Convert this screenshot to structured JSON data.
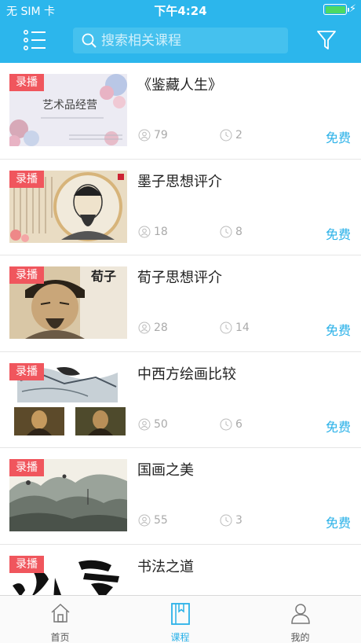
{
  "status_bar": {
    "carrier": "无 SIM 卡",
    "time": "下午4:24",
    "battery_state": "charging"
  },
  "header": {
    "menu_icon": "list-menu-icon",
    "search_placeholder": "搜索相关课程",
    "filter_icon": "filter-funnel-icon",
    "accent_color": "#2cb6ec"
  },
  "courses": [
    {
      "tag": "录播",
      "title": "《鉴藏人生》",
      "views": "79",
      "duration": "2",
      "price": "免费",
      "thumb": "art-appreciation-cover"
    },
    {
      "tag": "录播",
      "title": "墨子思想评介",
      "views": "18",
      "duration": "8",
      "price": "免费",
      "thumb": "mozi-portrait"
    },
    {
      "tag": "录播",
      "title": "荀子思想评介",
      "views": "28",
      "duration": "14",
      "price": "免费",
      "thumb": "xunzi-portrait"
    },
    {
      "tag": "录播",
      "title": "中西方绘画比较",
      "views": "50",
      "duration": "6",
      "price": "免费",
      "thumb": "painting-comparison"
    },
    {
      "tag": "录播",
      "title": "国画之美",
      "views": "55",
      "duration": "3",
      "price": "免费",
      "thumb": "landscape-painting"
    },
    {
      "tag": "录播",
      "title": "书法之道",
      "views": "",
      "duration": "",
      "price": "",
      "thumb": "calligraphy"
    }
  ],
  "thumb_texts": {
    "art_title": "艺术品经营",
    "xunzi_chars": "荀子"
  },
  "tabbar": {
    "items": [
      {
        "label": "首页",
        "icon": "home-icon",
        "active": false
      },
      {
        "label": "课程",
        "icon": "book-icon",
        "active": true
      },
      {
        "label": "我的",
        "icon": "user-icon",
        "active": false
      }
    ]
  }
}
